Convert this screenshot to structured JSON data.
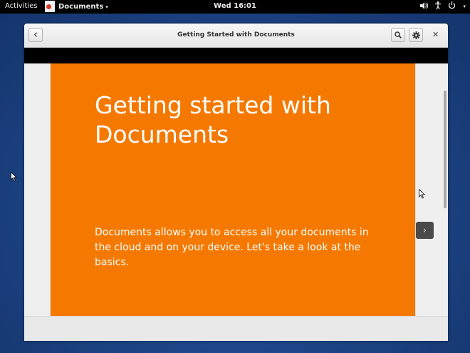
{
  "topbar": {
    "activities": "Activities",
    "app_menu_label": "Documents",
    "app_menu_caret": "▾",
    "clock": "Wed 16:01",
    "volume_icon": "volume-icon",
    "accessibility_icon": "accessibility-icon",
    "power_icon": "power-icon",
    "tray_caret": "▾"
  },
  "window": {
    "title": "Getting Started with Documents",
    "back_glyph": "‹",
    "close_glyph": "✕"
  },
  "slide": {
    "title": "Getting started with Documents",
    "body": "Documents allows you to access all your documents in the cloud and on your device. Let's take a look at the basics.",
    "background": "#f57900",
    "next_glyph": "›"
  }
}
